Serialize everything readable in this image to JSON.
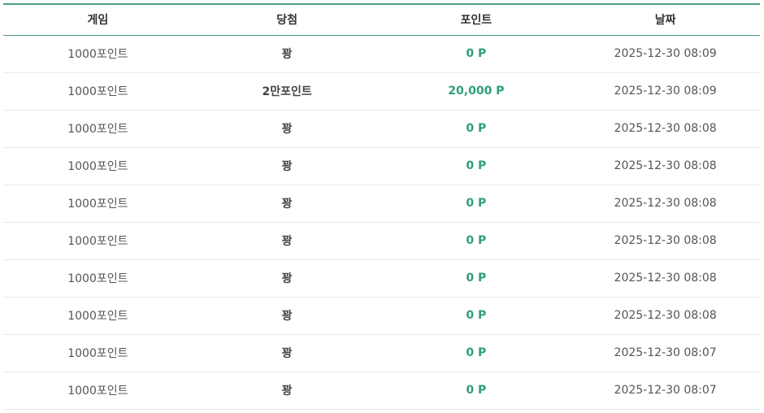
{
  "table": {
    "headers": [
      "게임",
      "당첨",
      "포인트",
      "날짜"
    ],
    "rows": [
      {
        "game": "1000포인트",
        "result": "꽝",
        "points": "0 P",
        "date": "2025-12-30 08:09"
      },
      {
        "game": "1000포인트",
        "result": "2만포인트",
        "points": "20,000 P",
        "date": "2025-12-30 08:09"
      },
      {
        "game": "1000포인트",
        "result": "꽝",
        "points": "0 P",
        "date": "2025-12-30 08:08"
      },
      {
        "game": "1000포인트",
        "result": "꽝",
        "points": "0 P",
        "date": "2025-12-30 08:08"
      },
      {
        "game": "1000포인트",
        "result": "꽝",
        "points": "0 P",
        "date": "2025-12-30 08:08"
      },
      {
        "game": "1000포인트",
        "result": "꽝",
        "points": "0 P",
        "date": "2025-12-30 08:08"
      },
      {
        "game": "1000포인트",
        "result": "꽝",
        "points": "0 P",
        "date": "2025-12-30 08:08"
      },
      {
        "game": "1000포인트",
        "result": "꽝",
        "points": "0 P",
        "date": "2025-12-30 08:08"
      },
      {
        "game": "1000포인트",
        "result": "꽝",
        "points": "0 P",
        "date": "2025-12-30 08:07"
      },
      {
        "game": "1000포인트",
        "result": "꽝",
        "points": "0 P",
        "date": "2025-12-30 08:07"
      }
    ]
  },
  "colors": {
    "accent": "#4f9e84",
    "points": "#2e9e7d",
    "row_divider": "#e9e9e9"
  }
}
